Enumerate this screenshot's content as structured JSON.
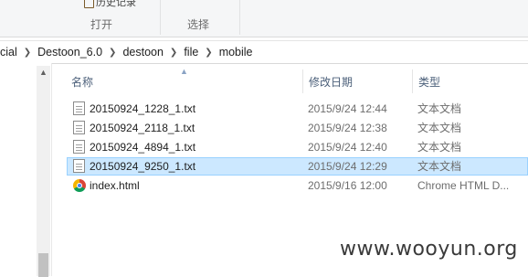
{
  "ribbon": {
    "partial_button_label": "历史记录",
    "groups": [
      "打开",
      "选择"
    ]
  },
  "address_bar": {
    "crumbs": [
      "cial",
      "Destoon_6.0",
      "destoon",
      "file",
      "mobile"
    ]
  },
  "columns": {
    "name": "名称",
    "date_modified": "修改日期",
    "type": "类型"
  },
  "files": [
    {
      "name": "20150924_1228_1.txt",
      "date": "2015/9/24 12:44",
      "type": "文本文档",
      "icon": "text-file-icon",
      "selected": false
    },
    {
      "name": "20150924_2118_1.txt",
      "date": "2015/9/24 12:38",
      "type": "文本文档",
      "icon": "text-file-icon",
      "selected": false
    },
    {
      "name": "20150924_4894_1.txt",
      "date": "2015/9/24 12:40",
      "type": "文本文档",
      "icon": "text-file-icon",
      "selected": false
    },
    {
      "name": "20150924_9250_1.txt",
      "date": "2015/9/24 12:29",
      "type": "文本文档",
      "icon": "text-file-icon",
      "selected": true
    },
    {
      "name": "index.html",
      "date": "2015/9/16 12:00",
      "type": "Chrome HTML D...",
      "icon": "chrome-icon",
      "selected": false
    }
  ],
  "watermark": "www.wooyun.org",
  "colors": {
    "selection_bg": "#cce8ff",
    "selection_border": "#99d1ff",
    "header_text": "#4c607a"
  }
}
